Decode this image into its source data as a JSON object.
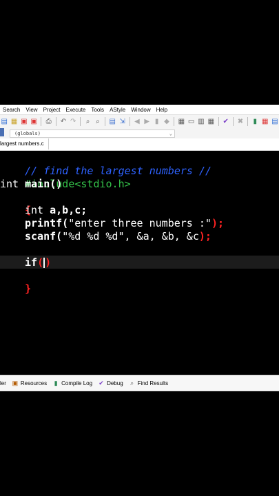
{
  "menu": {
    "items": [
      "Search",
      "View",
      "Project",
      "Execute",
      "Tools",
      "AStyle",
      "Window",
      "Help"
    ]
  },
  "globals": {
    "value": "(globals)"
  },
  "file_tab": {
    "name": "largest numbers.c"
  },
  "code": {
    "comment": "// find the largest numbers //",
    "include": "#include<stdio.h>",
    "int_kw": "int",
    "main": "main()",
    "open_brace": "{",
    "decl_type": "int",
    "decl_vars": " a,b,c;",
    "printf": "printf(",
    "printf_str": "\"enter three numbers :\"",
    "printf_end": ");",
    "scanf": "scanf(",
    "scanf_args": "\"%d %d %d\", &a, &b, &c",
    "scanf_end": ");",
    "if_kw": "if",
    "if_open": "(",
    "if_close": ")",
    "close_brace": "}"
  },
  "bottom_tabs": [
    "ler",
    "Resources",
    "Compile Log",
    "Debug",
    "Find Results"
  ],
  "colors": {
    "comment": "#2e62ff",
    "preprocessor": "#34c34a",
    "bracket": "#ff2222",
    "background": "#000000"
  }
}
